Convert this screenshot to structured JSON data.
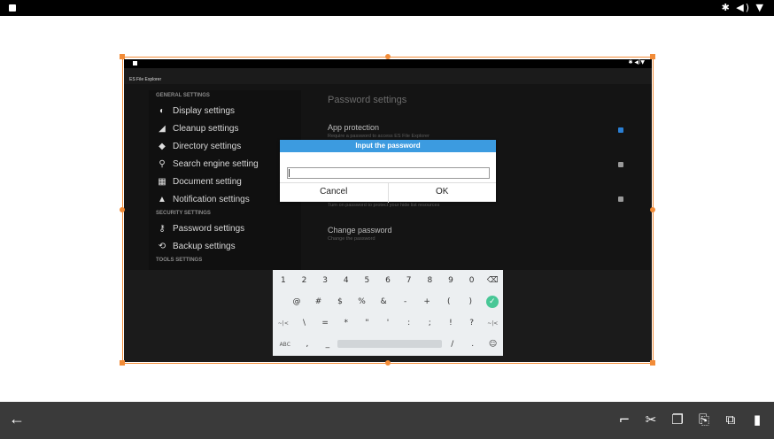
{
  "status_bar": {
    "right_icons": "✱ ◀) ▼"
  },
  "screenshot": {
    "status_icons": "✱ ◀)▼",
    "app_title": "ES File Explorer",
    "sections": {
      "general": "GENERAL SETTINGS",
      "security": "SECURITY SETTINGS",
      "tools": "TOOLS SETTINGS"
    },
    "nav": [
      {
        "label": "Display settings",
        "icon": "contrast-icon"
      },
      {
        "label": "Cleanup settings",
        "icon": "broom-icon"
      },
      {
        "label": "Directory settings",
        "icon": "diamond-icon"
      },
      {
        "label": "Search engine setting",
        "icon": "search-icon"
      },
      {
        "label": "Document setting",
        "icon": "book-icon"
      },
      {
        "label": "Notification settings",
        "icon": "bell-icon"
      },
      {
        "label": "Password settings",
        "icon": "key-icon"
      },
      {
        "label": "Backup settings",
        "icon": "restore-icon"
      }
    ],
    "right_title": "Password settings",
    "options": {
      "app_protection": {
        "title": "App protection",
        "subtitle": "Require a password to access ES File Explorer",
        "checked": true
      },
      "hide_list": {
        "subtitle": "Turn on password to protect your hide list resources",
        "checked": false
      },
      "change_password": {
        "title": "Change password",
        "subtitle": "Change the password"
      }
    },
    "dialog": {
      "title": "Input the password",
      "input_value": "",
      "cancel": "Cancel",
      "ok": "OK"
    },
    "keyboard": {
      "row1": [
        "1",
        "2",
        "3",
        "4",
        "5",
        "6",
        "7",
        "8",
        "9",
        "0",
        "⌫"
      ],
      "row2": [
        "@",
        "#",
        "$",
        "%",
        "&",
        "-",
        "+",
        "(",
        ")",
        "✓"
      ],
      "row3": [
        "~|<",
        "\\",
        "=",
        "*",
        "\"",
        "'",
        ":",
        ";",
        "!",
        "?",
        "~|<"
      ],
      "row4_left": "ABC",
      "row4_comma": ",",
      "row4_underscore": "_",
      "row4_slash": "/",
      "row4_dot": ".",
      "row4_emoji": "☺"
    }
  },
  "bottom_bar": {
    "back": "←",
    "tools": [
      {
        "name": "crop-icon",
        "glyph": "⌐"
      },
      {
        "name": "cut-icon",
        "glyph": "✂"
      },
      {
        "name": "copy-icon",
        "glyph": "❐"
      },
      {
        "name": "paste-icon",
        "glyph": "⎘"
      },
      {
        "name": "duplicate-icon",
        "glyph": "⧉"
      },
      {
        "name": "delete-icon",
        "glyph": "▮"
      }
    ]
  },
  "colors": {
    "accent": "#f28c38",
    "dialog_header": "#3c9be0",
    "checkbox_on": "#2a7fd4",
    "done_key": "#48c796"
  }
}
